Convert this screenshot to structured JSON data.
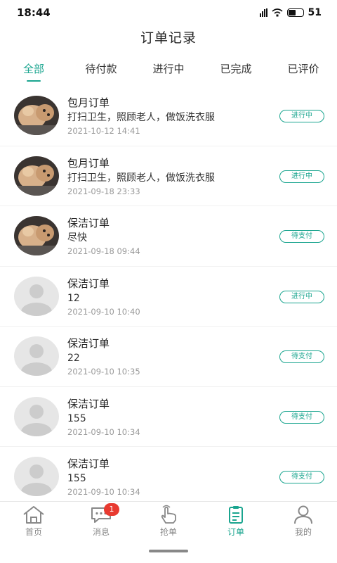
{
  "status_bar": {
    "time": "18:44",
    "battery": "51"
  },
  "header": {
    "title": "订单记录"
  },
  "tabs": [
    {
      "label": "全部",
      "active": true
    },
    {
      "label": "待付款",
      "active": false
    },
    {
      "label": "进行中",
      "active": false
    },
    {
      "label": "已完成",
      "active": false
    },
    {
      "label": "已评价",
      "active": false
    }
  ],
  "orders": [
    {
      "type": "包月订单",
      "desc": "打扫卫生，照顾老人，做饭洗衣服",
      "time": "2021-10-12 14:41",
      "status": "进行中",
      "avatar": "photo"
    },
    {
      "type": "包月订单",
      "desc": "打扫卫生，照顾老人，做饭洗衣服",
      "time": "2021-09-18 23:33",
      "status": "进行中",
      "avatar": "photo"
    },
    {
      "type": "保洁订单",
      "desc": "尽快",
      "time": "2021-09-18 09:44",
      "status": "待支付",
      "avatar": "photo"
    },
    {
      "type": "保洁订单",
      "desc": "12",
      "time": "2021-09-10 10:40",
      "status": "进行中",
      "avatar": "placeholder"
    },
    {
      "type": "保洁订单",
      "desc": "22",
      "time": "2021-09-10 10:35",
      "status": "待支付",
      "avatar": "placeholder"
    },
    {
      "type": "保洁订单",
      "desc": "155",
      "time": "2021-09-10 10:34",
      "status": "待支付",
      "avatar": "placeholder"
    },
    {
      "type": "保洁订单",
      "desc": "155",
      "time": "2021-09-10 10:34",
      "status": "待支付",
      "avatar": "placeholder"
    }
  ],
  "bottom_nav": [
    {
      "label": "首页",
      "icon": "home-icon",
      "active": false
    },
    {
      "label": "消息",
      "icon": "message-icon",
      "active": false,
      "badge": "1"
    },
    {
      "label": "抢单",
      "icon": "hand-tap-icon",
      "active": false
    },
    {
      "label": "订单",
      "icon": "order-clipboard-icon",
      "active": true
    },
    {
      "label": "我的",
      "icon": "user-icon",
      "active": false
    }
  ],
  "colors": {
    "accent": "#1aa58f",
    "badge": "#e83a30"
  }
}
